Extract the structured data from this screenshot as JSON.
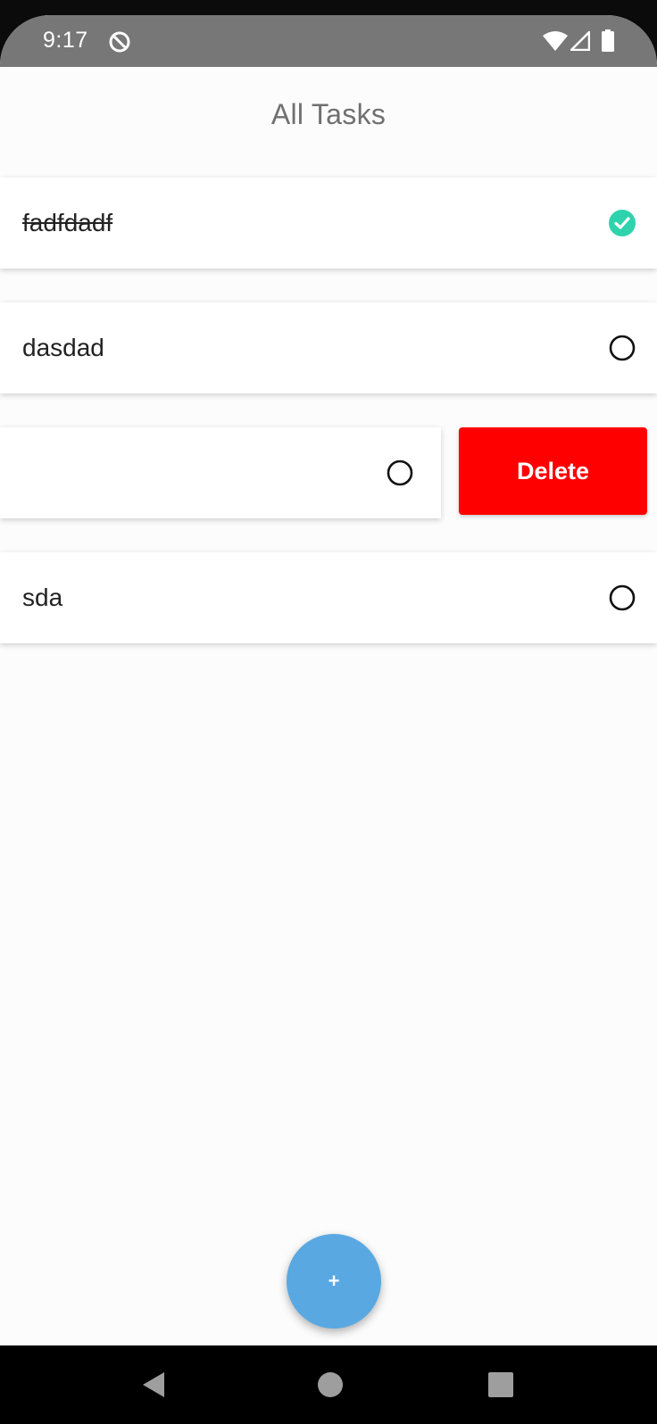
{
  "status_bar": {
    "time": "9:17",
    "icons": [
      "do-not-disturb-icon",
      "wifi-icon",
      "cellular-signal-icon",
      "battery-icon"
    ]
  },
  "app_bar": {
    "title": "All Tasks"
  },
  "tasks": [
    {
      "text": "fadfdadf",
      "completed": true
    },
    {
      "text": "dasdad",
      "completed": false
    },
    {
      "text": "",
      "completed": false,
      "swiped_open": true
    },
    {
      "text": "sda",
      "completed": false
    }
  ],
  "swipe_action": {
    "delete_label": "Delete"
  },
  "fab": {
    "label": "+"
  },
  "navigation_bar": {
    "icons": [
      "back-icon",
      "home-icon",
      "recents-icon"
    ]
  },
  "colors": {
    "status_bar": "#777777",
    "background": "#fcfcfc",
    "completed_check": "#2ed3ad",
    "delete": "#ff0000",
    "fab": "#5aa8e2",
    "title": "#707070"
  }
}
